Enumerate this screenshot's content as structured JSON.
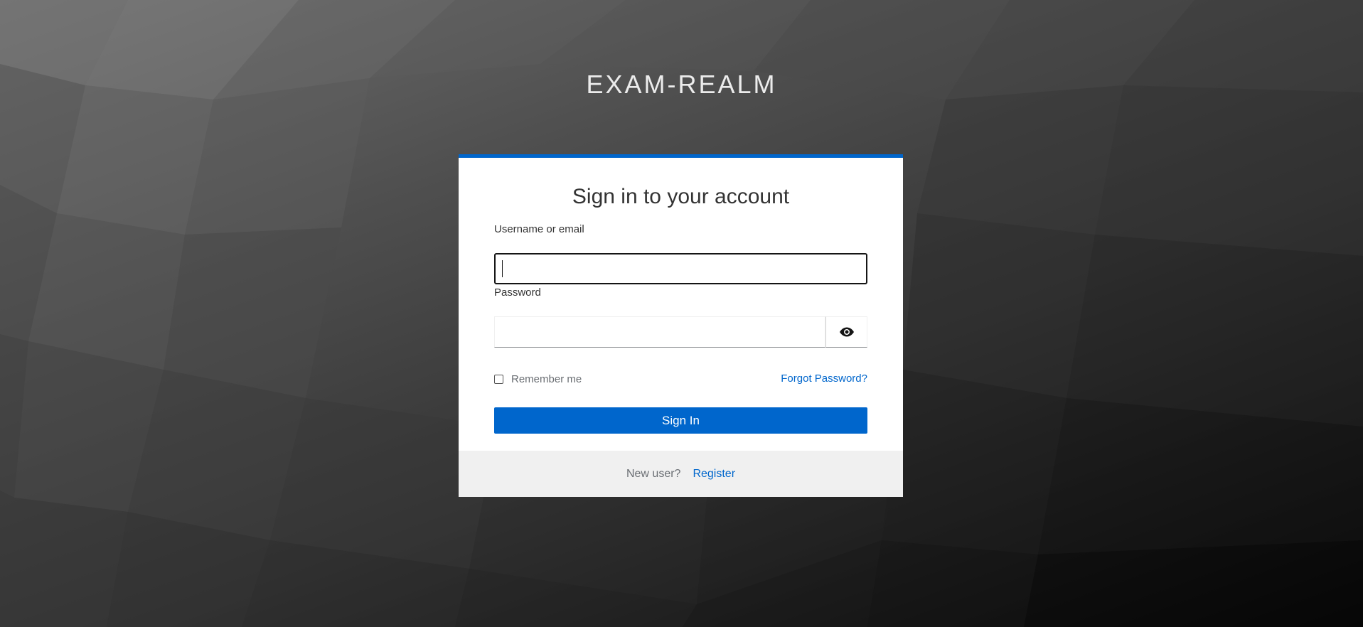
{
  "realm": {
    "title": "EXAM-REALM"
  },
  "login": {
    "heading": "Sign in to your account",
    "username": {
      "label": "Username or email",
      "value": "",
      "placeholder": ""
    },
    "password": {
      "label": "Password",
      "value": "",
      "placeholder": "",
      "toggle_icon": "eye-icon"
    },
    "remember_me": {
      "label": "Remember me",
      "checked": false
    },
    "forgot_password": "Forgot Password?",
    "submit_label": "Sign In"
  },
  "footer": {
    "new_user_text": "New user?",
    "register_label": "Register"
  },
  "colors": {
    "accent": "#0066cc",
    "card_background": "#ffffff",
    "footer_background": "#f0f0f0"
  }
}
